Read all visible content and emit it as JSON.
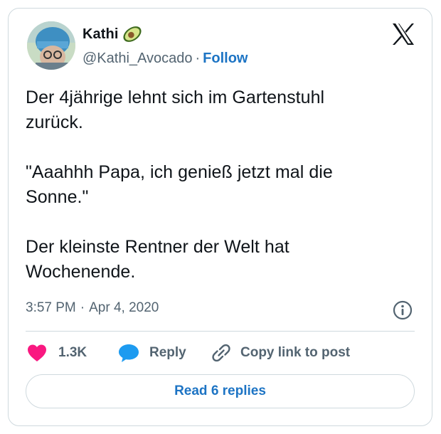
{
  "author": {
    "name": "Kathi",
    "handle": "@Kathi_Avocado",
    "separator": "·",
    "follow_label": "Follow"
  },
  "tweet": {
    "text": "Der 4jährige lehnt sich im Gartenstuhl\nzurück.\n\n\"Aaahhh Papa, ich genieß jetzt mal die\nSonne.\"\n\nDer kleinste Rentner der Welt hat\nWochenende."
  },
  "meta": {
    "time": "3:57 PM",
    "separator": "·",
    "date": "Apr 4, 2020"
  },
  "actions": {
    "like_count": "1.3K",
    "reply_label": "Reply",
    "copy_label": "Copy link to post"
  },
  "footer": {
    "read_replies_label": "Read 6 replies"
  },
  "colors": {
    "link": "#1d74c4",
    "like": "#f91880",
    "reply_icon": "#1d9bf0",
    "muted": "#536471",
    "border": "#cfd9de"
  },
  "icons": [
    "avocado-emoji-icon",
    "x-logo-icon",
    "info-icon",
    "heart-icon",
    "reply-bubble-icon",
    "link-icon"
  ]
}
